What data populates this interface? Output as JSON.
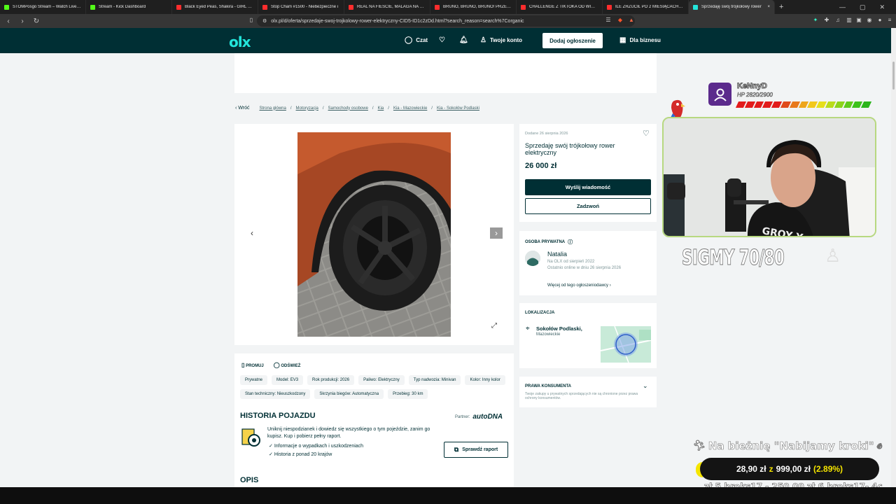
{
  "browser": {
    "tabs": [
      {
        "label": "STOMPosgo Stream – Watch Live on",
        "color": "#53fc18"
      },
      {
        "label": "Stream - Kick Dashboard",
        "color": "#53fc18"
      },
      {
        "label": "Black Eyed Peas, Shakira - GIRL LIKE",
        "color": "#ff2d2d"
      },
      {
        "label": "Stop Cham #1500 - Niebezpieczne i",
        "color": "#ff2d2d"
      },
      {
        "label": "REAL NA FIEŚCIE, MALAGA NA SIEŚ",
        "color": "#ff2d2d"
      },
      {
        "label": "BRUNO, BRUNO, BRUNO! PRZEPIĘ",
        "color": "#ff2d2d"
      },
      {
        "label": "CHALLENGE Z TIKTOKA OD WIDZÓW",
        "color": "#ff2d2d"
      },
      {
        "label": "ILE ZRZUCIŁ PO 2 MIESIĄCACH PRO",
        "color": "#ff2d2d"
      },
      {
        "label": "Sprzedaję swój trójkołowy rower",
        "color": "#23e5db",
        "active": true
      }
    ],
    "url": "olx.pl/d/oferta/sprzedaje-swoj-trojkolowy-rower-elektryczny-CID5-ID1c2zDd.html?search_reason=search%7Corganic"
  },
  "header": {
    "logo": "olx",
    "chat": "Czat",
    "account": "Twoje konto",
    "add_button": "Dodaj ogłoszenie",
    "business": "Dla biznesu"
  },
  "breadcrumb": {
    "back": "Wróć",
    "items": [
      "Strona główna",
      "Motoryzacja",
      "Samochody osobowe",
      "Kia",
      "Kia - Mazowieckie",
      "Kia - Sokołów Podlaski"
    ]
  },
  "listing": {
    "date": "Dodane 26 sierpnia 2026",
    "title": "Sprzedaję swój trójkołowy rower elektryczny",
    "price": "26 000 zł",
    "message_button": "Wyślij wiadomość",
    "call_button": "Zadzwoń"
  },
  "seller": {
    "header": "OSOBA PRYWATNA",
    "name": "Natalia",
    "since": "Na OLX od sierpień 2022",
    "online": "Ostatnio online w dniu 26 sierpnia 2026",
    "more_link": "Więcej od tego ogłoszeniodawcy"
  },
  "location": {
    "header": "LOKALIZACJA",
    "city": "Sokołów Podlaski,",
    "region": "Mazowieckie"
  },
  "consumer": {
    "header": "PRAWA KONSUMENTA",
    "text": "Twoje zakupy u prywatnych sprzedających nie są chronione przez prawa ochrony konsumentów."
  },
  "actions": {
    "promote": "PROMUJ",
    "refresh": "ODŚWIEŻ"
  },
  "params": [
    "Prywatne",
    "Model: EV3",
    "Rok produkcji: 2026",
    "Paliwo: Elektryczny",
    "Typ nadwozia: Minivan",
    "Kolor: Inny kolor",
    "Stan techniczny: Nieuszkodzony",
    "Skrzynia biegów: Automatyczna",
    "Przebieg: 30 km"
  ],
  "history": {
    "title": "HISTORIA POJAZDU",
    "partner_label": "Partner:",
    "partner": "autoDNA",
    "description": "Uniknij niespodzianek i dowiedz się wszystkiego o tym pojeździe, zanim go kupisz. Kup i pobierz pełny raport.",
    "bullet1": "Informacje o wypadkach i uszkodzeniach",
    "bullet2": "Historia z ponad 20 krajów",
    "report_button": "Sprawdź raport"
  },
  "description_title": "OPIS",
  "overlay": {
    "viewer_name": "KeNnyD",
    "hp": "HP 2820/2900",
    "hp_fraction": 0.97,
    "sigmy": "SIGMY 70/80",
    "treadmill": "Na bieżnię \"Nabijamy kroki\"",
    "goal_current": "28,90 zł",
    "goal_sep": "z",
    "goal_target": "999,00 zł",
    "goal_percent": "(2.89%)",
    "ticker": "zł 5.broks17 - 250,00 zł 6.broks17- 4c"
  }
}
